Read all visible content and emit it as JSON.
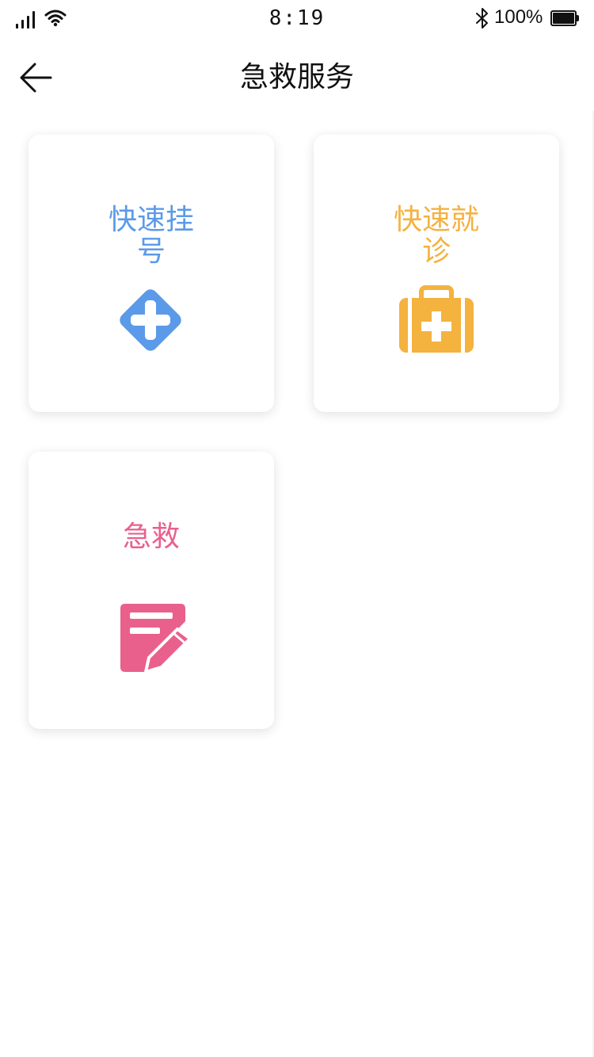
{
  "status_bar": {
    "time": "8:19",
    "battery_percent": "100%"
  },
  "header": {
    "title": "急救服务",
    "back_icon": "arrow-left-icon"
  },
  "colors": {
    "blue": "#5b9ae8",
    "orange": "#f4b23f",
    "pink": "#e9608d"
  },
  "services": [
    {
      "label": "快速挂号",
      "icon": "plus-diamond-icon",
      "color": "#5b9ae8"
    },
    {
      "label": "快速就诊",
      "icon": "first-aid-kit-icon",
      "color": "#f4b23f"
    },
    {
      "label": "急救",
      "icon": "edit-note-icon",
      "color": "#e9608d"
    }
  ]
}
